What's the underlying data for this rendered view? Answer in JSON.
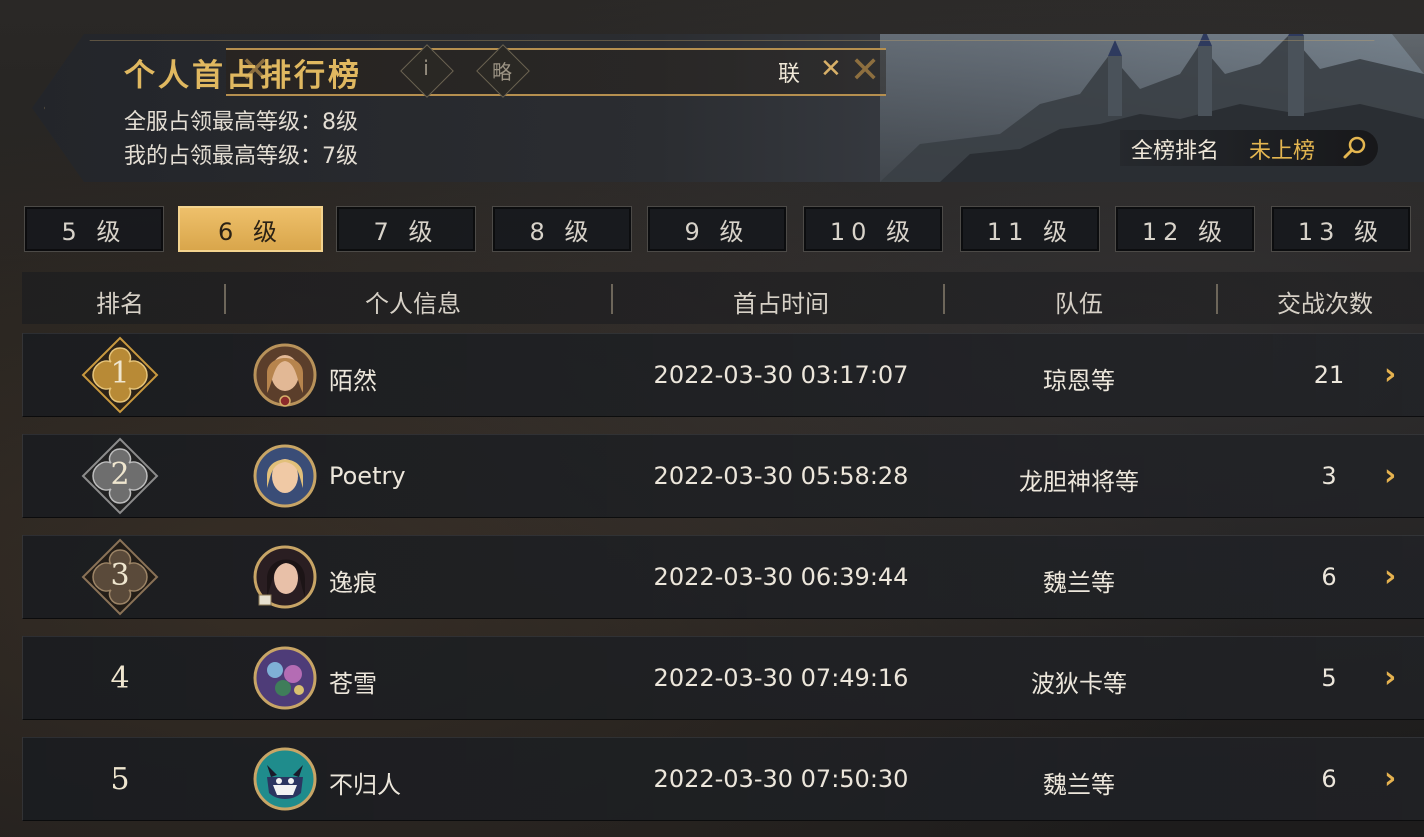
{
  "header": {
    "title": "个人首占排行榜",
    "strip_badge_1": "i",
    "strip_badge_2": "略",
    "strip_right_text": "联",
    "server_max_level": "全服占领最高等级：8级",
    "my_max_level": "我的占领最高等级：7级",
    "overall_rank_label": "全榜排名",
    "overall_rank_value": "未上榜"
  },
  "tabs": [
    {
      "label": "5 级",
      "active": false
    },
    {
      "label": "6 级",
      "active": true
    },
    {
      "label": "7 级",
      "active": false
    },
    {
      "label": "8 级",
      "active": false
    },
    {
      "label": "9 级",
      "active": false
    },
    {
      "label": "10 级",
      "active": false
    },
    {
      "label": "11 级",
      "active": false
    },
    {
      "label": "12 级",
      "active": false
    },
    {
      "label": "13 级",
      "active": false
    }
  ],
  "columns": {
    "rank": "排名",
    "info": "个人信息",
    "time": "首占时间",
    "team": "队伍",
    "battles": "交战次数"
  },
  "rows": [
    {
      "rank": "1",
      "badge": "gold-badge-icon",
      "name": "陌然",
      "time": "2022-03-30 03:17:07",
      "team": "琼恩等",
      "battles": "21"
    },
    {
      "rank": "2",
      "badge": "silver-badge-icon",
      "name": "Poetry",
      "time": "2022-03-30 05:58:28",
      "team": "龙胆神将等",
      "battles": "3"
    },
    {
      "rank": "3",
      "badge": "bronze-badge-icon",
      "name": "逸痕",
      "time": "2022-03-30 06:39:44",
      "team": "魏兰等",
      "battles": "6"
    },
    {
      "rank": "4",
      "badge": "",
      "name": "苍雪",
      "time": "2022-03-30 07:49:16",
      "team": "波狄卡等",
      "battles": "5"
    },
    {
      "rank": "5",
      "badge": "",
      "name": "不归人",
      "time": "2022-03-30 07:50:30",
      "team": "魏兰等",
      "battles": "6"
    }
  ],
  "colors": {
    "accent_gold": "#e4b650",
    "tab_active": "#eec06b",
    "badge_gold": "#c9993f",
    "badge_silver": "#8c8c8c",
    "badge_bronze": "#6e5a45"
  }
}
